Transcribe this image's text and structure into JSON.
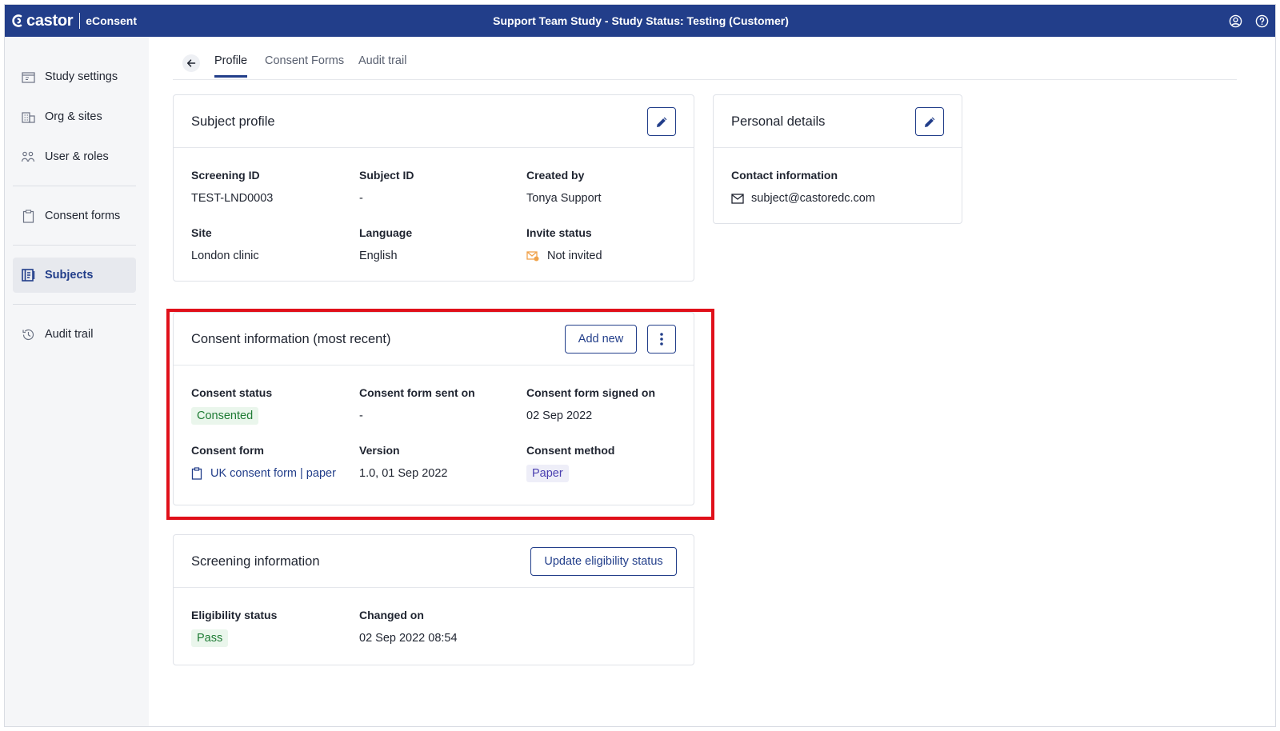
{
  "topbar": {
    "brand": "castor",
    "product": "eConsent",
    "title": "Support Team Study  - Study Status: Testing (Customer)",
    "icons": [
      "user-circle-icon",
      "help-circle-icon"
    ]
  },
  "sidebar": {
    "items": [
      {
        "label": "Study settings",
        "icon": "folder-icon"
      },
      {
        "label": "Org & sites",
        "icon": "building-icon"
      },
      {
        "label": "User & roles",
        "icon": "users-icon"
      },
      {
        "label": "Consent forms",
        "icon": "clipboard-icon"
      },
      {
        "label": "Subjects",
        "icon": "subjects-book-icon",
        "active": true
      },
      {
        "label": "Audit trail",
        "icon": "history-icon"
      }
    ]
  },
  "tabs": {
    "items": [
      "Profile",
      "Consent Forms",
      "Audit trail"
    ],
    "active": "Profile"
  },
  "subject_profile": {
    "title": "Subject profile",
    "fields": [
      {
        "label": "Screening ID",
        "value": "TEST-LND0003"
      },
      {
        "label": "Subject ID",
        "value": "-"
      },
      {
        "label": "Created by",
        "value": "Tonya Support"
      },
      {
        "label": "Site",
        "value": "London clinic"
      },
      {
        "label": "Language",
        "value": "English"
      },
      {
        "label": "Invite status",
        "value": "Not invited"
      }
    ]
  },
  "personal_details": {
    "title": "Personal details",
    "contact_label": "Contact information",
    "email": "subject@castoredc.com"
  },
  "consent_info": {
    "title": "Consent information (most recent)",
    "add_new": "Add new",
    "fields": [
      {
        "label": "Consent status",
        "value": "Consented"
      },
      {
        "label": "Consent form sent on",
        "value": "-"
      },
      {
        "label": "Consent form signed on",
        "value": "02 Sep 2022"
      },
      {
        "label": "Consent form",
        "value": "UK consent form | paper"
      },
      {
        "label": "Version",
        "value": "1.0, 01 Sep 2022"
      },
      {
        "label": "Consent method",
        "value": "Paper"
      }
    ]
  },
  "screening_info": {
    "title": "Screening information",
    "update_button": "Update eligibility status",
    "fields": [
      {
        "label": "Eligibility status",
        "value": "Pass"
      },
      {
        "label": "Changed on",
        "value": "02 Sep 2022 08:54"
      }
    ]
  },
  "colors": {
    "brand_blue": "#223e8a",
    "status_green": "#1e7b34",
    "method_purple": "#4a3fb0",
    "highlight_red": "#e0101a",
    "invite_orange": "#f0a24a"
  }
}
